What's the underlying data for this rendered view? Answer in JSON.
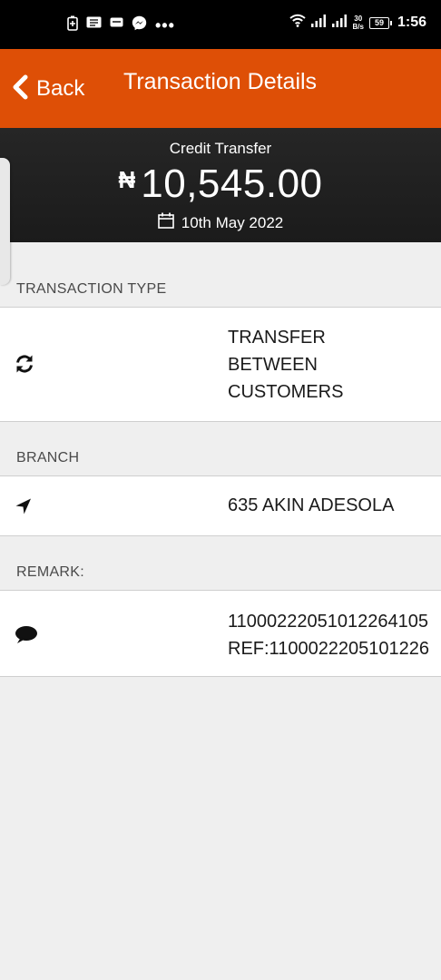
{
  "status_bar": {
    "time": "1:56",
    "network_speed_value": "30",
    "network_speed_unit": "B/s",
    "battery_level": "59",
    "more_indicator": "•••"
  },
  "app_bar": {
    "back_label": "Back",
    "title": "Transaction Details"
  },
  "summary": {
    "type": "Credit Transfer",
    "currency_symbol": "₦",
    "amount": "10,545.00",
    "date": "10th May 2022"
  },
  "sections": {
    "transaction_type": {
      "header": "TRANSACTION TYPE",
      "lines": [
        "TRANSFER",
        "BETWEEN",
        "CUSTOMERS"
      ],
      "icon": "refresh-icon"
    },
    "branch": {
      "header": "BRANCH",
      "value": "635 AKIN ADESOLA",
      "icon": "location-arrow-icon"
    },
    "remark": {
      "header": "REMARK:",
      "lines": [
        "11000222051012264105",
        "REF:1100022205101226"
      ],
      "icon": "comment-icon"
    }
  },
  "colors": {
    "accent": "#de4f06",
    "summary_bg": "#1f1f1f",
    "page_bg": "#efefef"
  }
}
